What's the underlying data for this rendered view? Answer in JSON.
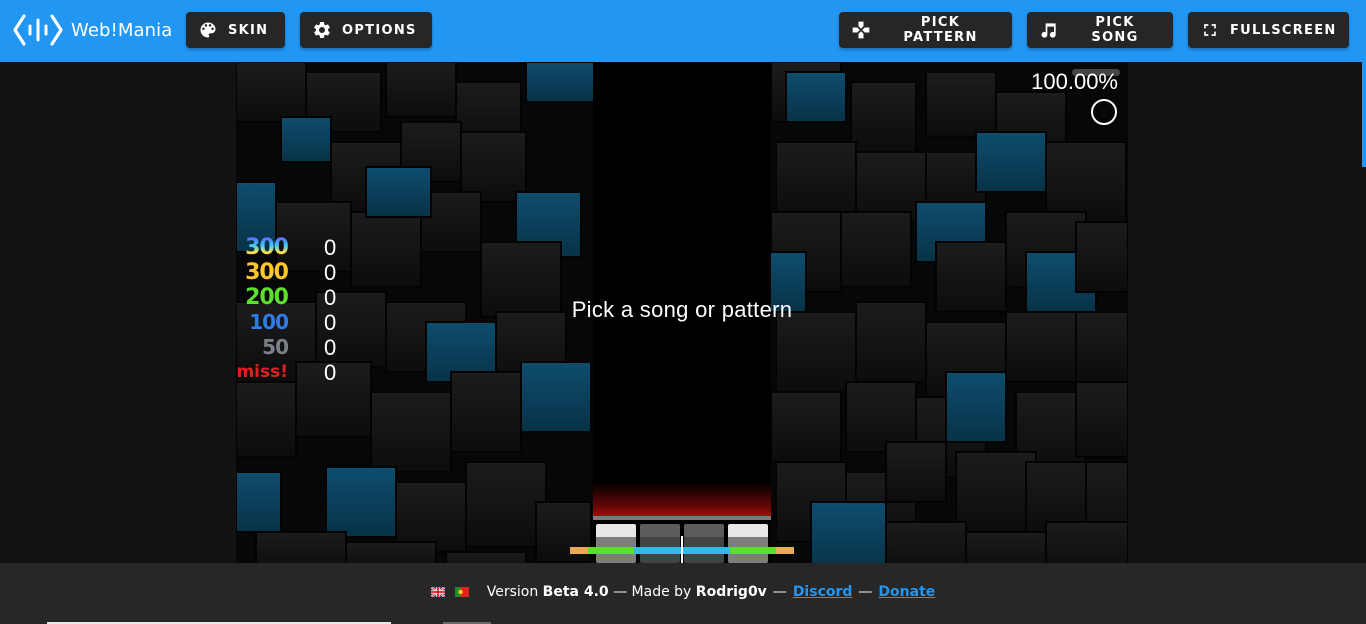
{
  "app": {
    "name": "Web!Mania",
    "logo_icon": "code-wave-logo-icon"
  },
  "toolbar": {
    "skin": {
      "label": "SKIN",
      "icon": "palette-icon"
    },
    "options": {
      "label": "OPTIONS",
      "icon": "gear-icon"
    },
    "pick_pattern": {
      "label": "PICK PATTERN",
      "icon": "gamepad-icon"
    },
    "pick_song": {
      "label": "PICK SONG",
      "icon": "music-note-icon"
    },
    "fullscreen": {
      "label": "FULLSCREEN",
      "icon": "fullscreen-icon"
    }
  },
  "game": {
    "message": "Pick a song or pattern",
    "accuracy": "100.00%",
    "keys": 4,
    "receptors": [
      "light",
      "dark",
      "dark",
      "light"
    ],
    "judgements": [
      {
        "label": "300",
        "count": "0",
        "kind": "max"
      },
      {
        "label": "300",
        "count": "0",
        "kind": "300"
      },
      {
        "label": "200",
        "count": "0",
        "kind": "200"
      },
      {
        "label": "100",
        "count": "0",
        "kind": "100"
      },
      {
        "label": "50",
        "count": "0",
        "kind": "50"
      },
      {
        "label": "miss!",
        "count": "0",
        "kind": "miss"
      }
    ],
    "hit_error_bar": {
      "colors": {
        "outer": "#e8a95a",
        "mid": "#5ddf2a",
        "inner": "#33b9ea"
      }
    }
  },
  "footer": {
    "flags": [
      "uk-flag-icon",
      "portugal-flag-icon"
    ],
    "version_prefix": "Version",
    "version": "Beta 4.0",
    "made_by_prefix": "— Made by",
    "author": "Rodrig0v",
    "sep": "—",
    "discord_label": "Discord",
    "donate_label": "Donate"
  },
  "colors": {
    "accent": "#2196f3",
    "button_bg": "#262626",
    "footer_bg": "#272727",
    "page_bg": "#121212"
  }
}
